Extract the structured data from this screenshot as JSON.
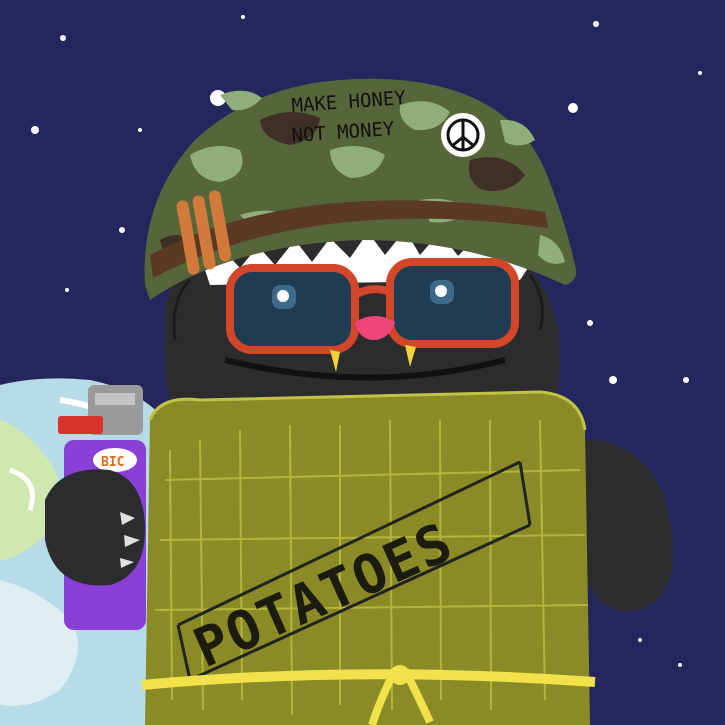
{
  "helmet": {
    "slogan_line1": "MAKE HONEY",
    "slogan_line2": "NOT MONEY"
  },
  "lighter": {
    "brand": "BIC"
  },
  "sack": {
    "label": "POTATOES"
  },
  "colors": {
    "sky": "#26265e",
    "fur": "#2c2c2e",
    "helmet_camo_base": "#56663a",
    "sack": "#8a8a26",
    "glasses_frame": "#d2462a",
    "lens": "#1f3c52",
    "lighter_body": "#8a3fd6",
    "rope": "#f1e14a",
    "earth_water": "#b7dbe7"
  },
  "icons": [
    "peace-icon",
    "star-icon"
  ]
}
